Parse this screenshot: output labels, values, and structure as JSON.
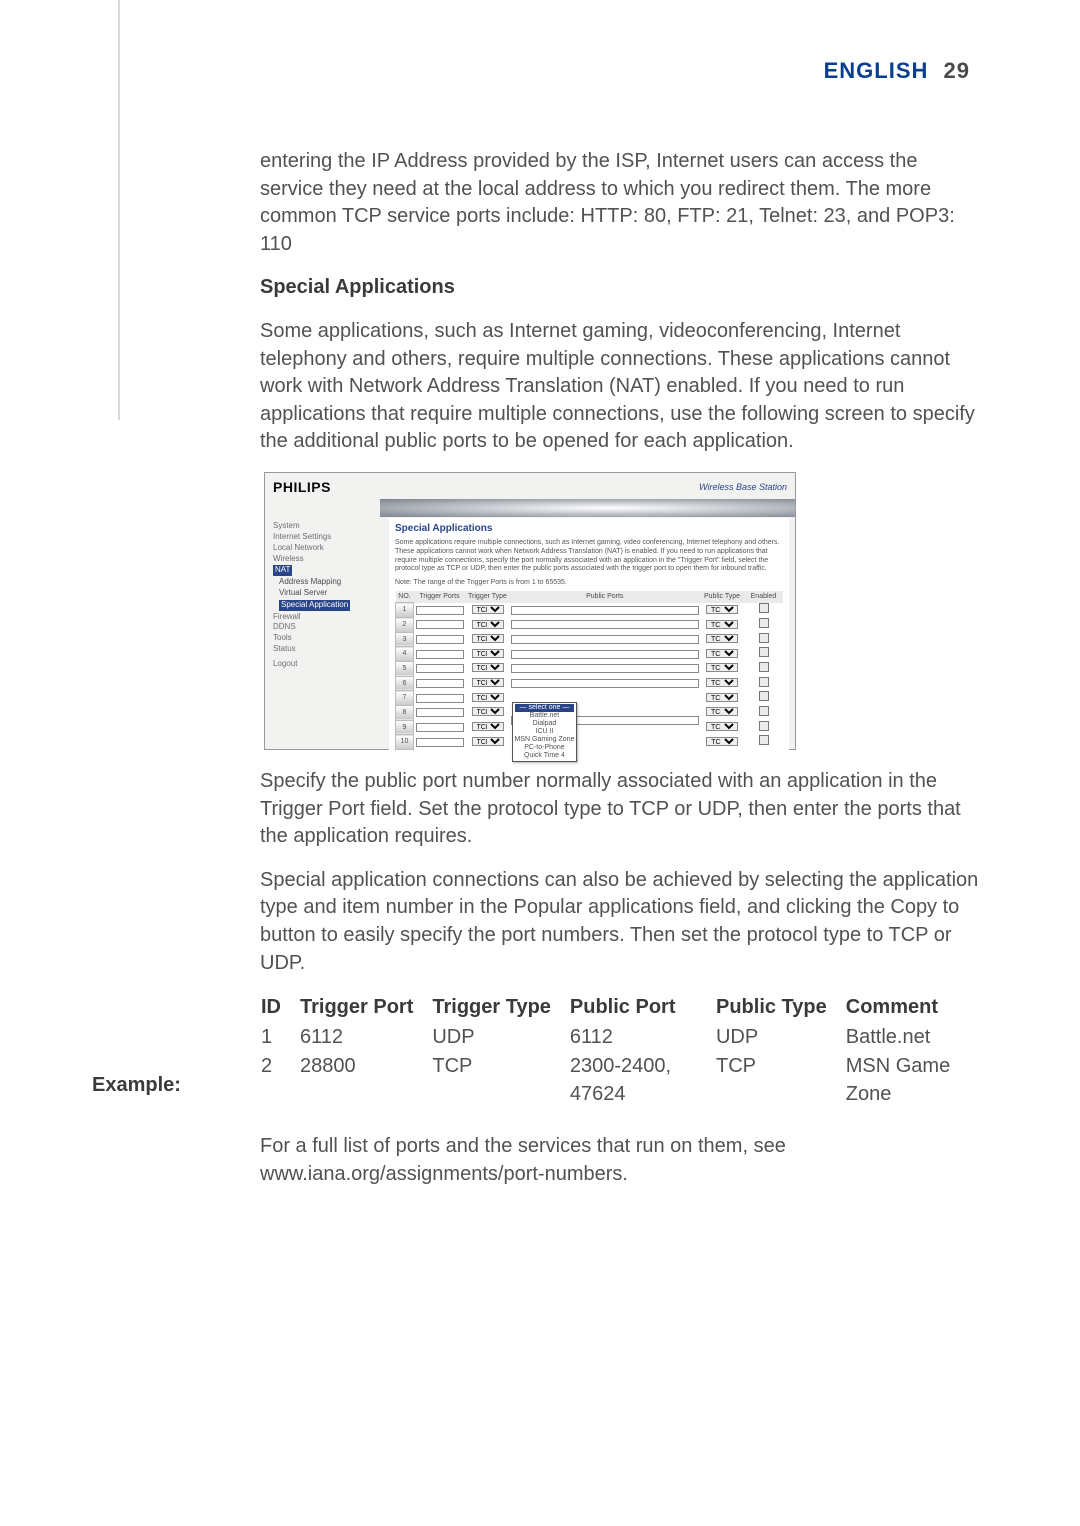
{
  "header": {
    "language": "ENGLISH",
    "page_number": "29"
  },
  "intro_paragraph": "entering the IP Address provided by the ISP, Internet users can access the service they need at the local address to which you redirect them. The more common TCP service ports include: HTTP: 80, FTP: 21, Telnet: 23, and POP3: 110",
  "section_heading": "Special Applications",
  "section_paragraph": "Some applications, such as Internet gaming, videoconferencing, Internet telephony and others, require multiple connections. These applications cannot work with Network Address Translation (NAT) enabled. If you need to run applications that require multiple connections, use the following screen to specify the additional public ports to be opened for each application.",
  "screenshot": {
    "brand": "PHILIPS",
    "product": "Wireless Base Station",
    "nav": {
      "items": [
        "System",
        "Internet Settings",
        "Local Network",
        "Wireless",
        "NAT",
        "Address Mapping",
        "Virtual Server",
        "Special Application",
        "Firewall",
        "DDNS",
        "Tools",
        "Status",
        "Logout"
      ],
      "selected": "NAT",
      "selected_sub": "Special Application"
    },
    "panel": {
      "title": "Special Applications",
      "text": "Some applications require multiple connections, such as Internet gaming, video conferencing, Internet telephony and others. These applications cannot work when Network Address Translation (NAT) is enabled. If you need to run applications that require multiple connections, specify the port normally associated with an application in the \"Trigger Port\" field, select the protocol type as TCP or UDP, then enter the public ports associated with the trigger port to open them for inbound traffic.",
      "note": "Note: The range of the Trigger Ports is from 1 to 65535.",
      "columns": [
        "NO.",
        "Trigger Ports",
        "Trigger Type",
        "Public Ports",
        "Public Type",
        "Enabled"
      ],
      "popular_apps": [
        "— select one —",
        "Battle.net",
        "Dialpad",
        "ICU II",
        "MSN Gaming Zone",
        "PC-to-Phone",
        "Quick Time 4"
      ]
    }
  },
  "para_after_1": "Specify the public port number normally associated with an application in the Trigger Port field. Set the protocol type to TCP or UDP, then enter the ports that the application requires.",
  "para_after_2": "Special application connections can also be achieved by selecting the application type and item number in the Popular applications field, and clicking the Copy to button to easily specify the port numbers. Then set the protocol type to TCP or UDP.",
  "example_label": "Example:",
  "example_table": {
    "headers": [
      "ID",
      "Trigger Port",
      "Trigger Type",
      "Public Port",
      "Public Type",
      "Comment"
    ],
    "rows": [
      {
        "id": "1",
        "trigger_port": "6112",
        "trigger_type": "UDP",
        "public_port": "6112",
        "public_type": "UDP",
        "comment": "Battle.net"
      },
      {
        "id": "2",
        "trigger_port": "28800",
        "trigger_type": "TCP",
        "public_port": "2300-2400, 47624",
        "public_type": "TCP",
        "comment": "MSN Game Zone"
      }
    ]
  },
  "closing_1": "For a full list of ports and the services that run on them, see",
  "closing_2": "www.iana.org/assignments/port-numbers.",
  "chart_data": {
    "type": "table",
    "title": "Special Applications port example",
    "columns": [
      "ID",
      "Trigger Port",
      "Trigger Type",
      "Public Port",
      "Public Type",
      "Comment"
    ],
    "rows": [
      [
        1,
        6112,
        "UDP",
        "6112",
        "UDP",
        "Battle.net"
      ],
      [
        2,
        28800,
        "TCP",
        "2300-2400, 47624",
        "TCP",
        "MSN Game Zone"
      ]
    ]
  }
}
